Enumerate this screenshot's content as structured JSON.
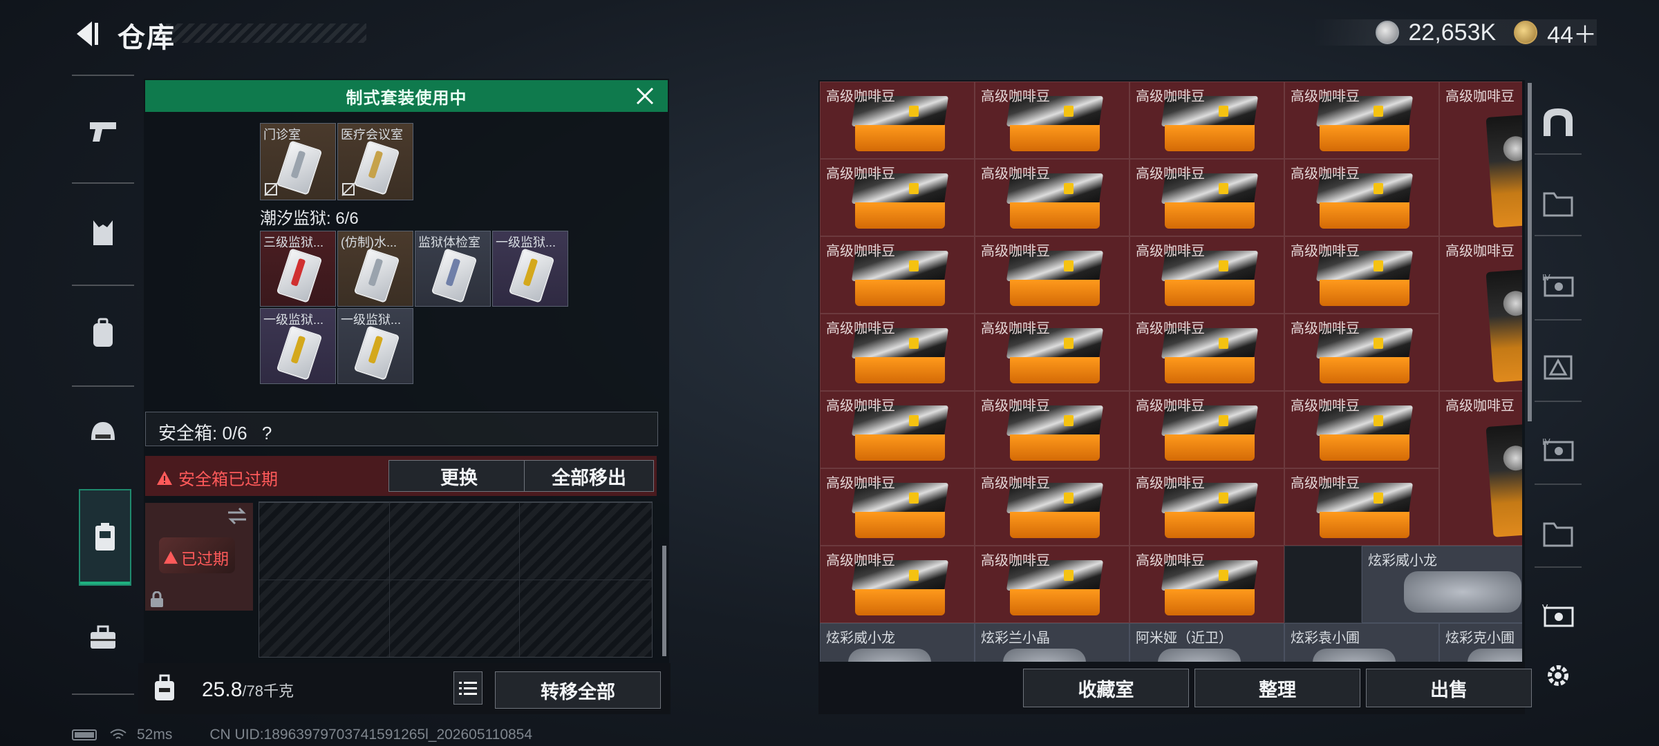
{
  "header": {
    "title": "仓库"
  },
  "currency": {
    "silver": "22,653K",
    "gold": "44＋"
  },
  "left_panel": {
    "banner": "制式套装使用中",
    "top_items": [
      {
        "label": "门诊室"
      },
      {
        "label": "医疗会议室"
      }
    ],
    "prison_title": "潮汐监狱: 6/6",
    "prison_items": [
      {
        "label": "三级监狱..."
      },
      {
        "label": "(仿制)水..."
      },
      {
        "label": "监狱体检室"
      },
      {
        "label": "一级监狱..."
      },
      {
        "label": "一级监狱..."
      },
      {
        "label": "一级监狱..."
      }
    ],
    "safe_box_label": "安全箱: 0/6",
    "safe_box_help": "?",
    "expired_warning": "安全箱已过期",
    "replace_button": "更换",
    "remove_all_button": "全部移出",
    "slot_expired": "已过期",
    "weight_value": "25.8",
    "weight_max": "/78千克",
    "transfer_all_button": "转移全部"
  },
  "right_panel": {
    "item_label": "高级咖啡豆",
    "last_row": [
      "高级咖啡豆",
      "高级咖啡豆",
      "高级咖啡豆"
    ],
    "dragon_item": "炫彩威小龙",
    "bottom_row": [
      "炫彩威小龙",
      "炫彩兰小晶",
      "阿米娅（近卫）",
      "炫彩袁小圃",
      "炫彩克小圃"
    ],
    "collection_button": "收藏室",
    "sort_button": "整理",
    "sell_button": "出售"
  },
  "status_bar": {
    "ping": "52ms",
    "uid": "CN UID:18963979703741591265l_202605110854"
  },
  "colors": {
    "accent_green": "#0f7a4d",
    "item_red": "#5b2126",
    "warning_red": "#ff5a5a"
  }
}
